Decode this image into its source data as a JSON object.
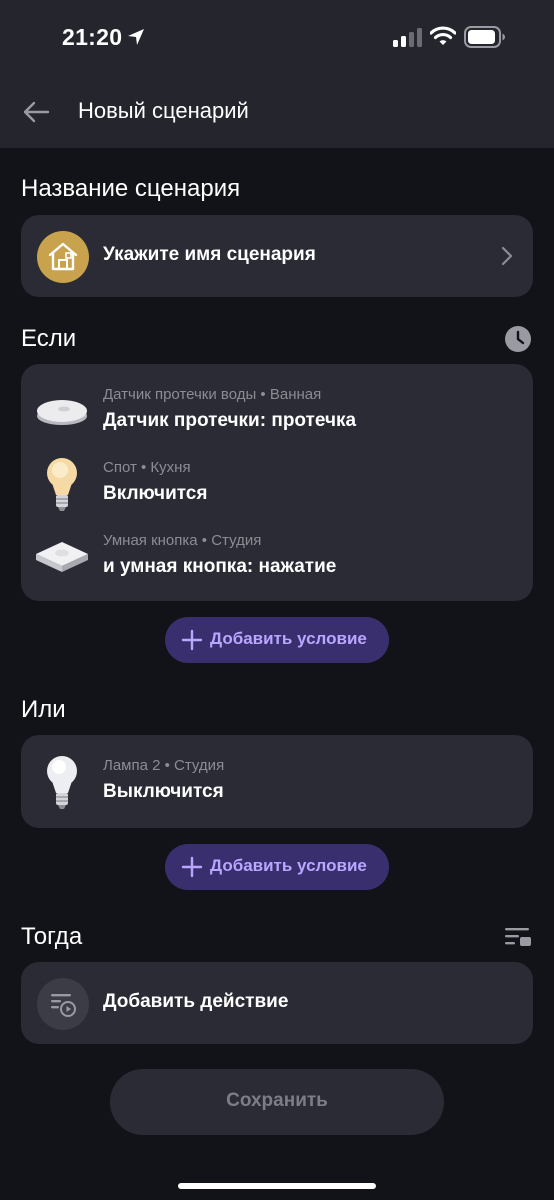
{
  "status_bar": {
    "time": "21:20"
  },
  "nav": {
    "title": "Новый сценарий"
  },
  "name_section": {
    "title": "Название сценария",
    "placeholder": "Укажите имя сценария"
  },
  "if_section": {
    "title": "Если",
    "conditions": [
      {
        "device": "Датчик протечки воды • Ванная",
        "event": "Датчик протечки: протечка",
        "icon": "leak-sensor-icon"
      },
      {
        "device": "Спот • Кухня",
        "event": "Включится",
        "icon": "warm-bulb-icon"
      },
      {
        "device": "Умная кнопка • Студия",
        "event": "и умная кнопка: нажатие",
        "icon": "smart-button-icon"
      }
    ],
    "add_label": "Добавить условие"
  },
  "or_section": {
    "title": "Или",
    "conditions": [
      {
        "device": "Лампа 2 • Студия",
        "event": "Выключится",
        "icon": "white-bulb-icon"
      }
    ],
    "add_label": "Добавить условие"
  },
  "then_section": {
    "title": "Тогда",
    "action_label": "Добавить действие"
  },
  "save_label": "Сохранить",
  "colors": {
    "background": "#121318",
    "card": "#2a2b34",
    "accent_purple": "#b9a6ff",
    "house_icon_bg": "#c9a24e"
  }
}
